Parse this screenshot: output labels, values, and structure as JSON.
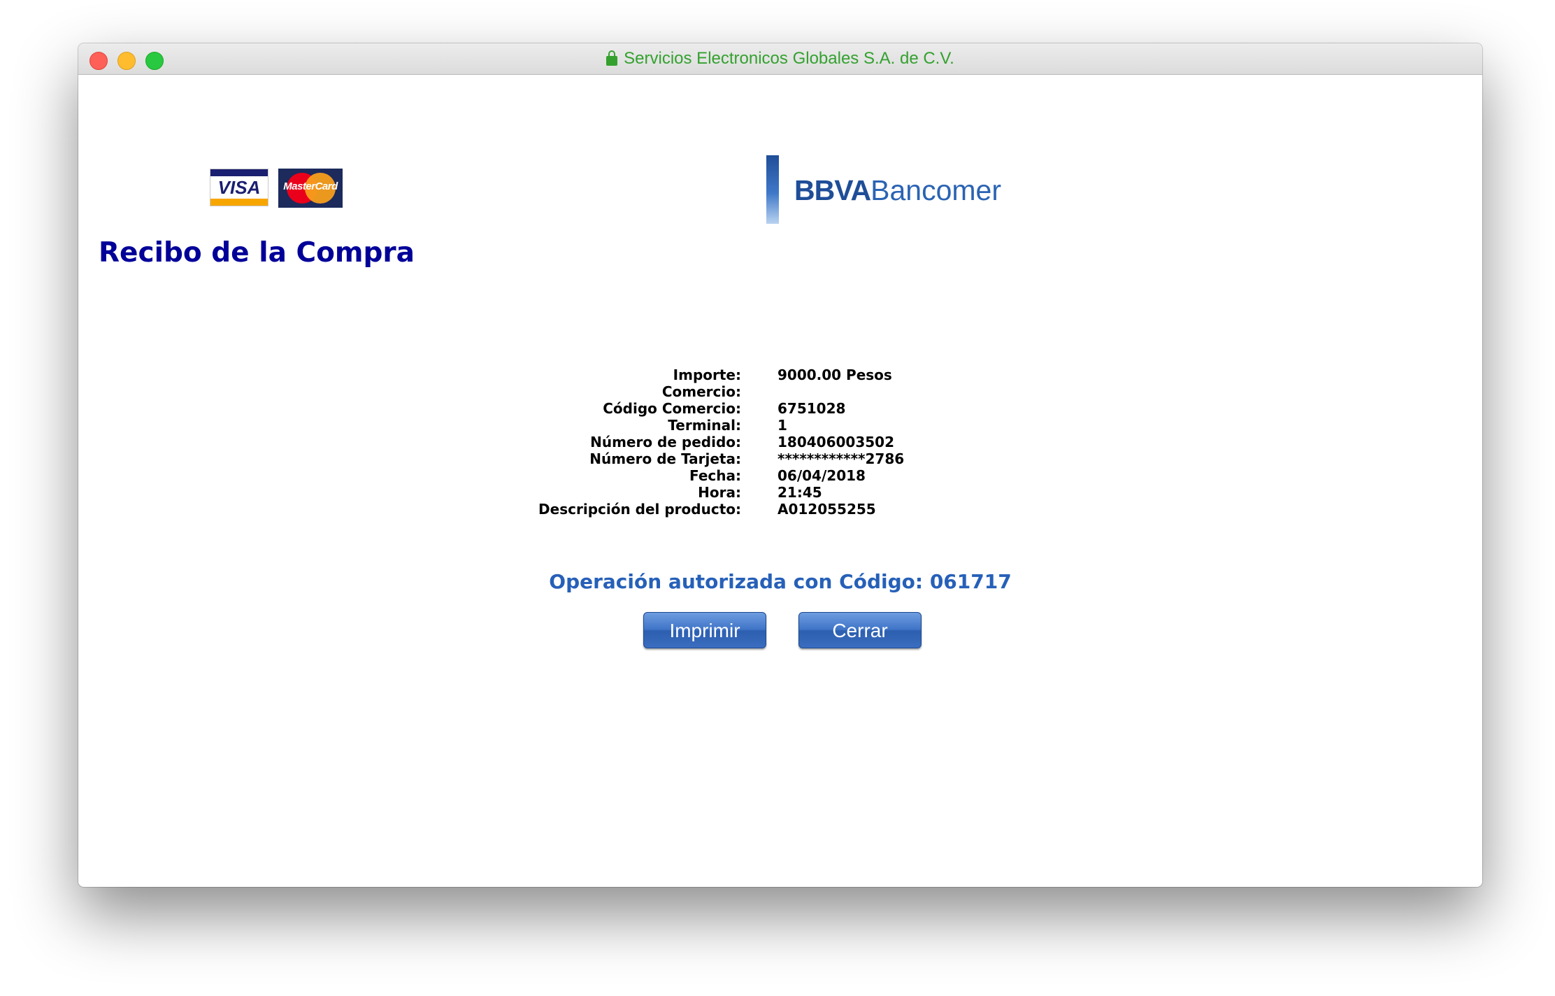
{
  "window": {
    "title": "Servicios Electronicos Globales S.A. de C.V."
  },
  "logos": {
    "visa": "VISA",
    "mastercard": "MasterCard",
    "bank_short": "BBVA",
    "bank_name": "Bancomer"
  },
  "page": {
    "title": "Recibo de la Compra"
  },
  "receipt": {
    "rows": [
      {
        "label": "Importe:",
        "value": "9000.00 Pesos"
      },
      {
        "label": "Comercio:",
        "value": ""
      },
      {
        "label": "Código Comercio:",
        "value": "6751028"
      },
      {
        "label": "Terminal:",
        "value": "1"
      },
      {
        "label": "Número de pedido:",
        "value": "180406003502"
      },
      {
        "label": "Número de Tarjeta:",
        "value": "************2786"
      },
      {
        "label": "Fecha:",
        "value": "06/04/2018"
      },
      {
        "label": "Hora:",
        "value": "21:45"
      },
      {
        "label": "Descripción del producto:",
        "value": "A012055255"
      }
    ]
  },
  "authorization": {
    "text": "Operación autorizada con Código: 061717"
  },
  "buttons": {
    "print": "Imprimir",
    "close": "Cerrar"
  },
  "colors": {
    "title": "#000099",
    "authorization": "#2660b8",
    "secure_title": "#34a12f",
    "button": "#3f74c8"
  },
  "icons": {
    "lock": "lock-icon"
  }
}
